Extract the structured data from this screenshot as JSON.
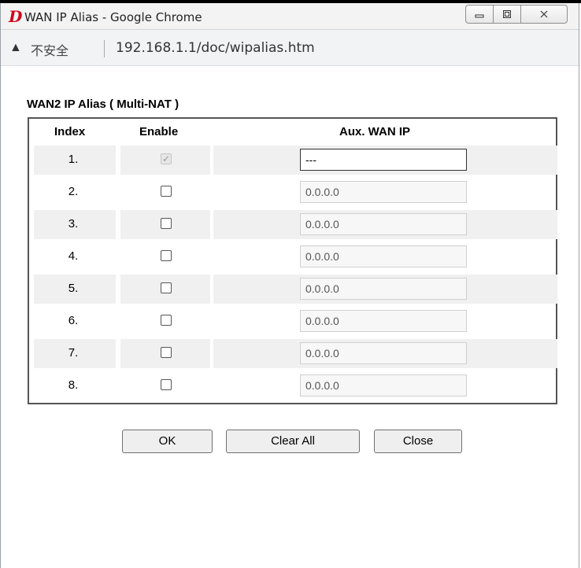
{
  "window": {
    "title": "WAN IP Alias - Google Chrome",
    "controls": [
      "minimize",
      "maximize",
      "close"
    ]
  },
  "address_bar": {
    "security_label": "不安全",
    "url": "192.168.1.1/doc/wipalias.htm"
  },
  "section": {
    "title": "WAN2  IP Alias ( Multi-NAT )"
  },
  "table": {
    "headers": {
      "index": "Index",
      "enable": "Enable",
      "aux_wan_ip": "Aux. WAN IP"
    },
    "rows": [
      {
        "index": "1.",
        "enabled": true,
        "ip": "---"
      },
      {
        "index": "2.",
        "enabled": false,
        "ip": "0.0.0.0"
      },
      {
        "index": "3.",
        "enabled": false,
        "ip": "0.0.0.0"
      },
      {
        "index": "4.",
        "enabled": false,
        "ip": "0.0.0.0"
      },
      {
        "index": "5.",
        "enabled": false,
        "ip": "0.0.0.0"
      },
      {
        "index": "6.",
        "enabled": false,
        "ip": "0.0.0.0"
      },
      {
        "index": "7.",
        "enabled": false,
        "ip": "0.0.0.0"
      },
      {
        "index": "8.",
        "enabled": false,
        "ip": "0.0.0.0"
      }
    ]
  },
  "buttons": {
    "ok": "OK",
    "clear_all": "Clear All",
    "close": "Close"
  },
  "colors": {
    "logo": "#d0021b"
  }
}
